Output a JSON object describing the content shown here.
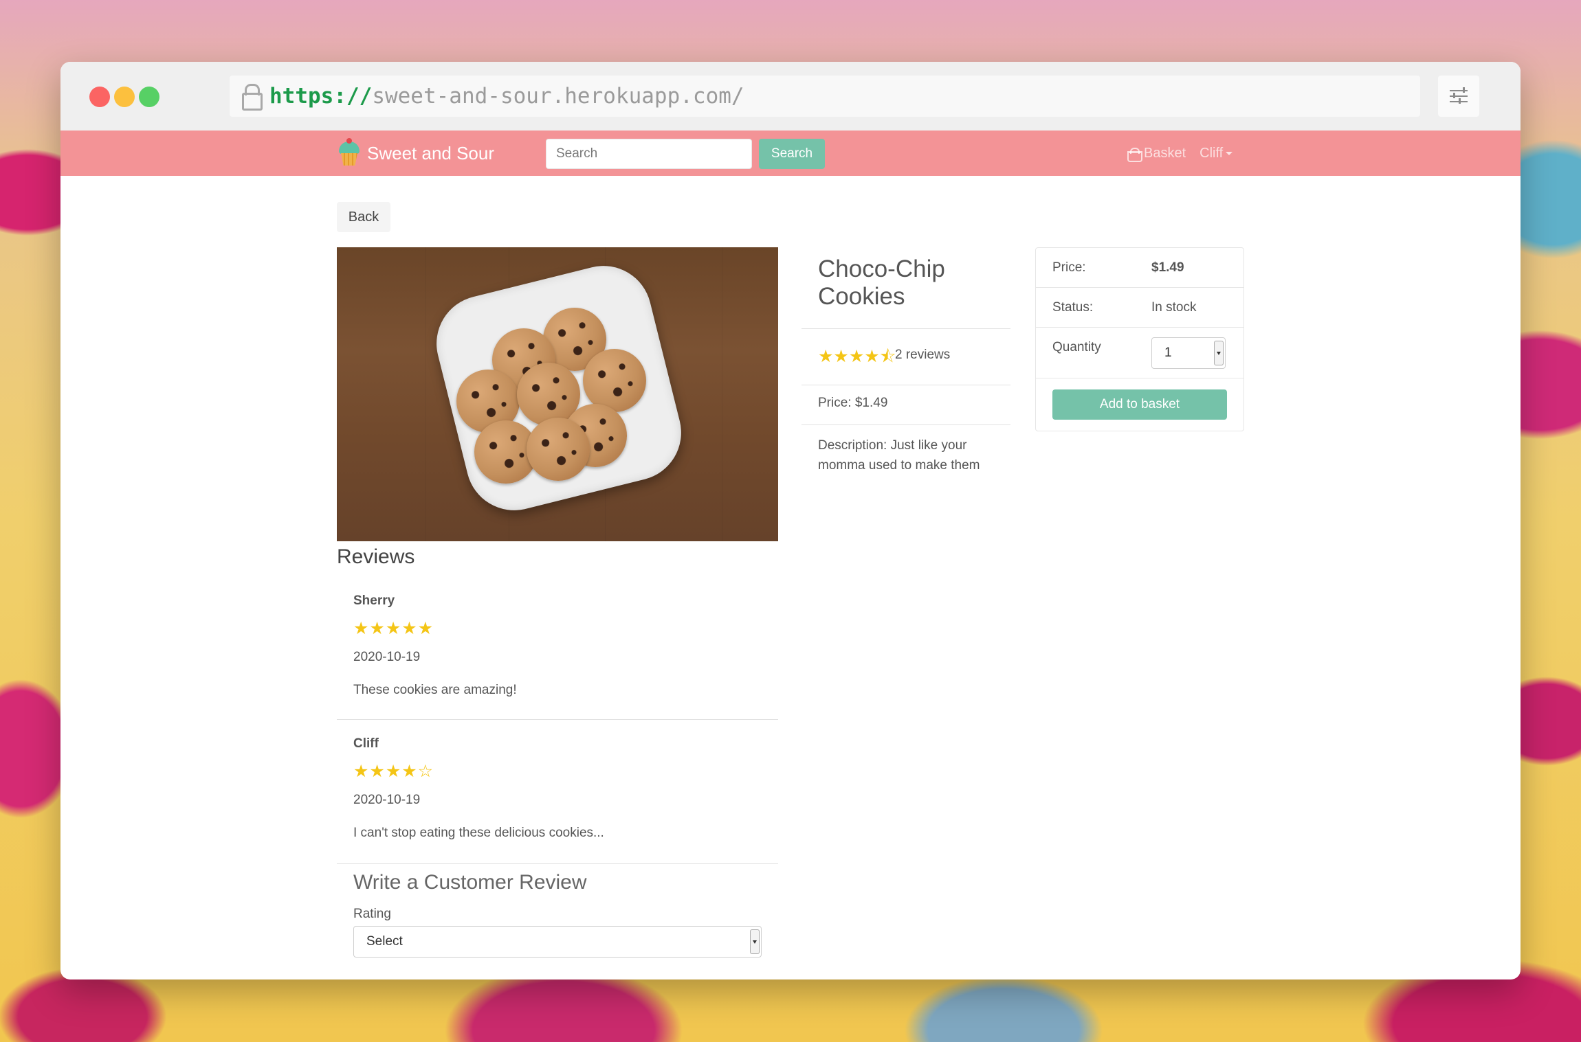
{
  "browser": {
    "url_protocol": "https://",
    "url_host": "sweet-and-sour.herokuapp.com/"
  },
  "navbar": {
    "brand": "Sweet and Sour",
    "search_placeholder": "Search",
    "search_button": "Search",
    "basket_label": "Basket",
    "user_label": "Cliff"
  },
  "page": {
    "back_label": "Back"
  },
  "product": {
    "name": "Choco-Chip Cookies",
    "rating_stars": "★★★★⯪",
    "rating_value": 4.5,
    "reviews_count_label": "2 reviews",
    "price_line": "Price: $1.49",
    "description": "Description: Just like your momma used to make them"
  },
  "buy_box": {
    "price_label": "Price:",
    "price_value": "$1.49",
    "status_label": "Status:",
    "status_value": "In stock",
    "quantity_label": "Quantity",
    "quantity_value": "1",
    "add_button": "Add to basket"
  },
  "reviews": {
    "title": "Reviews",
    "items": [
      {
        "name": "Sherry",
        "stars": "★★★★★",
        "rating": 5,
        "date": "2020-10-19",
        "comment": "These cookies are amazing!"
      },
      {
        "name": "Cliff",
        "stars": "★★★★☆",
        "rating": 4,
        "date": "2020-10-19",
        "comment": "I can't stop eating these delicious cookies..."
      }
    ]
  },
  "review_form": {
    "title": "Write a Customer Review",
    "rating_label": "Rating",
    "rating_selected": "Select"
  },
  "colors": {
    "navbar": "#f39396",
    "accent": "#75c2a9",
    "stars": "#f4c516"
  }
}
